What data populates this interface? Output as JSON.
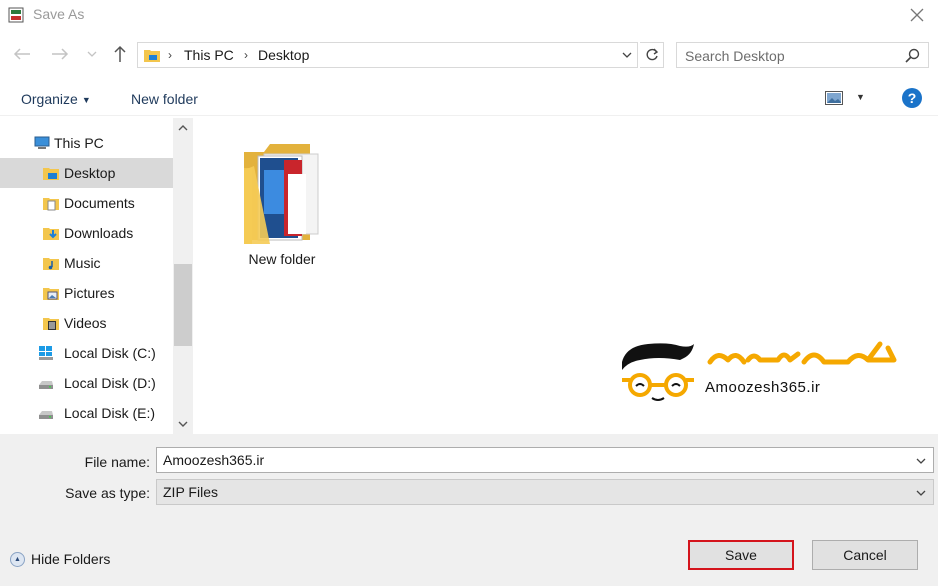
{
  "window": {
    "title": "Save As"
  },
  "address_bar": {
    "crumbs": [
      "This PC",
      "Desktop"
    ]
  },
  "search": {
    "placeholder": "Search Desktop"
  },
  "toolbar": {
    "organize_label": "Organize",
    "new_folder_label": "New folder"
  },
  "nav_pane": {
    "items": [
      {
        "label": "This PC",
        "icon": "computer-icon",
        "selected": false
      },
      {
        "label": "Desktop",
        "icon": "desktop-folder-icon",
        "selected": true
      },
      {
        "label": "Documents",
        "icon": "documents-folder-icon",
        "selected": false
      },
      {
        "label": "Downloads",
        "icon": "downloads-folder-icon",
        "selected": false
      },
      {
        "label": "Music",
        "icon": "music-folder-icon",
        "selected": false
      },
      {
        "label": "Pictures",
        "icon": "pictures-folder-icon",
        "selected": false
      },
      {
        "label": "Videos",
        "icon": "videos-folder-icon",
        "selected": false
      },
      {
        "label": "Local Disk (C:)",
        "icon": "windows-drive-icon",
        "selected": false
      },
      {
        "label": "Local Disk (D:)",
        "icon": "drive-icon",
        "selected": false
      },
      {
        "label": "Local Disk (E:)",
        "icon": "drive-icon",
        "selected": false
      }
    ]
  },
  "content": {
    "items": [
      {
        "label": "New folder",
        "icon": "folder-icon"
      }
    ]
  },
  "watermark": {
    "persian_text": "آموزش ۳۶۵",
    "domain": "Amoozesh365.ir"
  },
  "form": {
    "file_name_label": "File name:",
    "file_name_value": "Amoozesh365.ir",
    "save_type_label": "Save as type:",
    "save_type_value": "ZIP Files"
  },
  "footer": {
    "hide_folders_label": "Hide Folders",
    "save_label": "Save",
    "cancel_label": "Cancel"
  },
  "colors": {
    "accent": "#1a73c9",
    "save_highlight": "#d4141c",
    "folder": "#f3c64d",
    "watermark_orange": "#f5a800"
  }
}
